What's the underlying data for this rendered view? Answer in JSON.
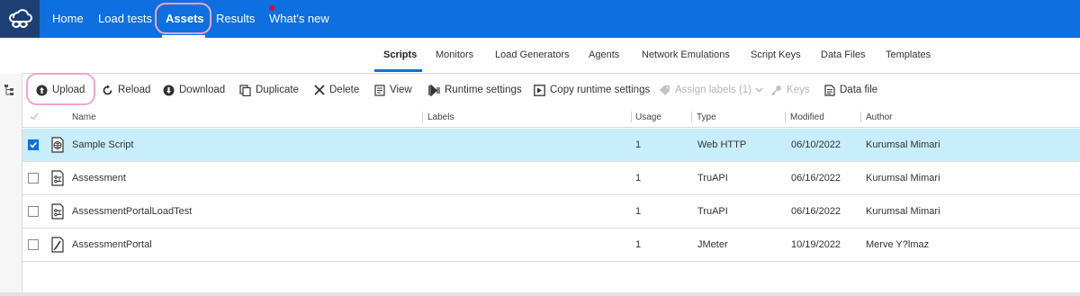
{
  "nav": {
    "items": [
      {
        "label": "Home"
      },
      {
        "label": "Load tests"
      },
      {
        "label": "Assets"
      },
      {
        "label": "Results"
      },
      {
        "label": "What's new"
      }
    ],
    "active": "Assets"
  },
  "subtabs": [
    "Scripts",
    "Monitors",
    "Load Generators",
    "Agents",
    "Network Emulations",
    "Script Keys",
    "Data Files",
    "Templates"
  ],
  "toolbar": {
    "upload": "Upload",
    "reload": "Reload",
    "download": "Download",
    "duplicate": "Duplicate",
    "delete": "Delete",
    "view": "View",
    "runtime_settings": "Runtime settings",
    "copy_runtime_settings": "Copy runtime settings",
    "assign_labels": "Assign labels (1)",
    "keys": "Keys",
    "data_file": "Data file"
  },
  "table": {
    "headers": {
      "name": "Name",
      "labels": "Labels",
      "usage": "Usage",
      "type": "Type",
      "modified": "Modified",
      "author": "Author"
    },
    "rows": [
      {
        "name": "Sample Script",
        "usage": "1",
        "type": "Web HTTP",
        "modified": "06/10/2022",
        "author": "Kurumsal Mimari",
        "selected": true,
        "icon": "web-script-icon"
      },
      {
        "name": "Assessment",
        "usage": "1",
        "type": "TruAPI",
        "modified": "06/16/2022",
        "author": "Kurumsal Mimari",
        "selected": false,
        "icon": "truapi-script-icon"
      },
      {
        "name": "AssessmentPortalLoadTest",
        "usage": "1",
        "type": "TruAPI",
        "modified": "06/16/2022",
        "author": "Kurumsal Mimari",
        "selected": false,
        "icon": "truapi-script-icon"
      },
      {
        "name": "AssessmentPortal",
        "usage": "1",
        "type": "JMeter",
        "modified": "10/19/2022",
        "author": "Merve Y?lmaz",
        "selected": false,
        "icon": "jmeter-script-icon"
      }
    ]
  },
  "colors": {
    "nav_bg": "#0d6fe0",
    "logo_bg": "#1d3f73",
    "selected_row": "#c7eefa",
    "highlight": "#f0a6c8"
  }
}
